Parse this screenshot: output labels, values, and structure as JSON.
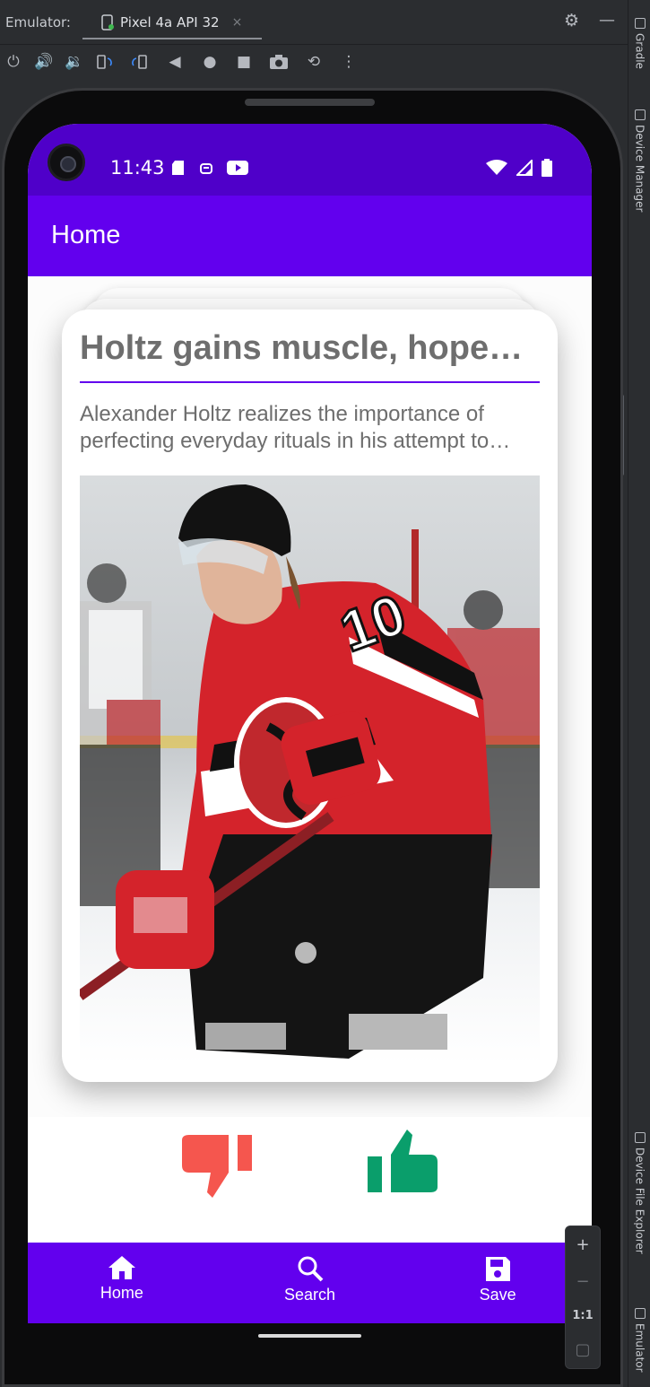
{
  "ide": {
    "label": "Emulator:",
    "device_tab": "Pixel 4a API 32",
    "tab_close": "×",
    "side_tabs": [
      "Gradle",
      "Device Manager",
      "Device File Explorer",
      "Emulator"
    ],
    "zoom": {
      "plus": "+",
      "minus": "−",
      "ratio": "1:1"
    }
  },
  "status": {
    "time": "11:43"
  },
  "app": {
    "title": "Home"
  },
  "article": {
    "title": "Holtz gains muscle, hopes to make impact with Devils",
    "description": "Alexander Holtz realizes the importance of perfecting everyday rituals in his attempt to make the Devils roster.",
    "image_alt": "Hockey player in red Devils jersey number 10",
    "jersey_number": "10"
  },
  "nav": {
    "items": [
      {
        "label": "Home",
        "icon": "home-icon"
      },
      {
        "label": "Search",
        "icon": "search-icon"
      },
      {
        "label": "Save",
        "icon": "save-icon"
      }
    ]
  },
  "colors": {
    "status_bar": "#4f00c9",
    "primary": "#6200ee",
    "dislike": "#f5564e",
    "like": "#0a9e6b"
  }
}
